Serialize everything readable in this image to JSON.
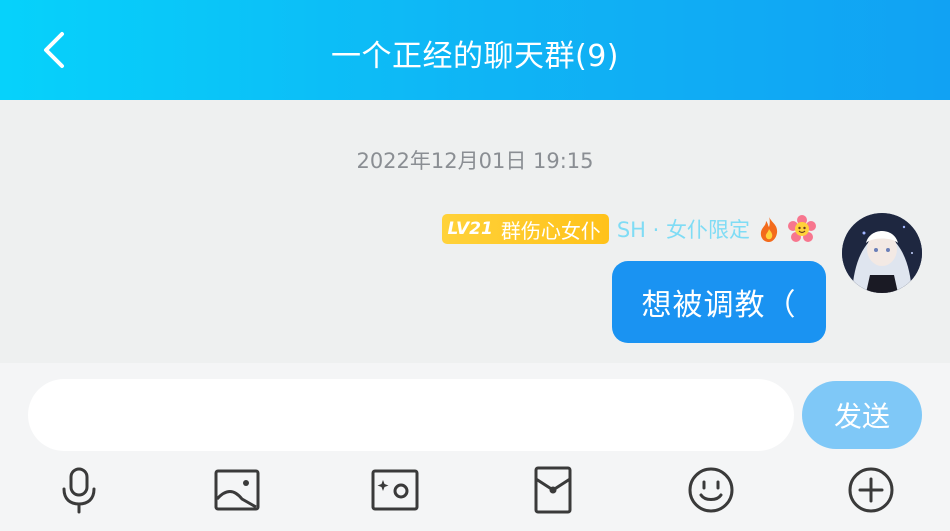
{
  "header": {
    "title": "一个正经的聊天群(9)",
    "back_icon": "back-chevron-icon",
    "background": "#0fb5f5"
  },
  "chat": {
    "timestamp": "2022年12月01日 19:15",
    "message": {
      "level": "LV21",
      "badge_text": "群伤心女仆",
      "group_title": "SH · 女仆限定",
      "decorations": [
        "fire-icon",
        "flower-icon"
      ],
      "text": "想被调教（",
      "bubble_color": "#1a93f2"
    }
  },
  "composer": {
    "input_value": "",
    "send_label": "发送",
    "send_color": "#7fc8f7"
  },
  "toolbar": [
    "microphone-icon",
    "image-icon",
    "camera-icon",
    "red-packet-icon",
    "emoji-icon",
    "plus-icon"
  ]
}
